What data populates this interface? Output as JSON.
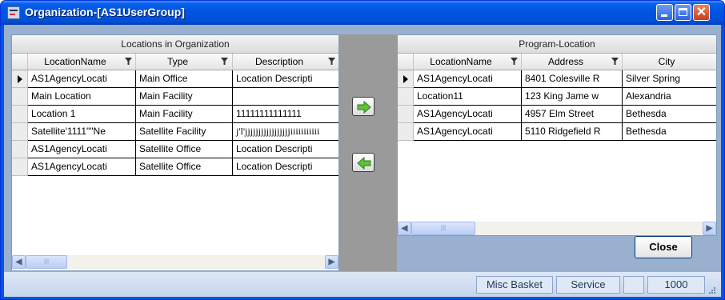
{
  "window": {
    "title": "Organization-[AS1UserGroup]",
    "close_glyph": "✕"
  },
  "left_grid": {
    "caption": "Locations in Organization",
    "columns": [
      "LocationName",
      "Type",
      "Description"
    ],
    "rows": [
      [
        "AS1AgencyLocati",
        "Main Office",
        "Location Descripti"
      ],
      [
        "Main Location",
        "Main Facility",
        ""
      ],
      [
        "Location 1",
        "Main Facility",
        "11111111111111"
      ],
      [
        "Satellite'1111\"\"Ne",
        "Satellite Facility",
        "j'l'jjjjjjjjjjjjjjjjjiiiiiiiiiii"
      ],
      [
        "AS1AgencyLocati",
        "Satellite Office",
        "Location Descripti"
      ],
      [
        "AS1AgencyLocati",
        "Satellite Office",
        "Location Descripti"
      ]
    ]
  },
  "right_grid": {
    "caption": "Program-Location",
    "columns": [
      "LocationName",
      "Address",
      "City"
    ],
    "rows": [
      [
        "AS1AgencyLocati",
        "8401 Colesville R",
        "Silver Spring"
      ],
      [
        "Location11",
        "123 King Jame w",
        "Alexandria"
      ],
      [
        "AS1AgencyLocati",
        "4957 Elm Street",
        "Bethesda"
      ],
      [
        "AS1AgencyLocati",
        "5110 Ridgefield R",
        "Bethesda"
      ]
    ]
  },
  "buttons": {
    "close_label": "Close",
    "add_icon": "arrow-right-icon",
    "remove_icon": "arrow-left-icon"
  },
  "statusbar": {
    "panel1": "Misc Basket",
    "panel2": "Service",
    "panel3": "",
    "panel4": "1000"
  },
  "colors": {
    "titlebar": "#0054e3",
    "client": "#9ab0cf",
    "arrow_fill": "#5cc23a"
  }
}
